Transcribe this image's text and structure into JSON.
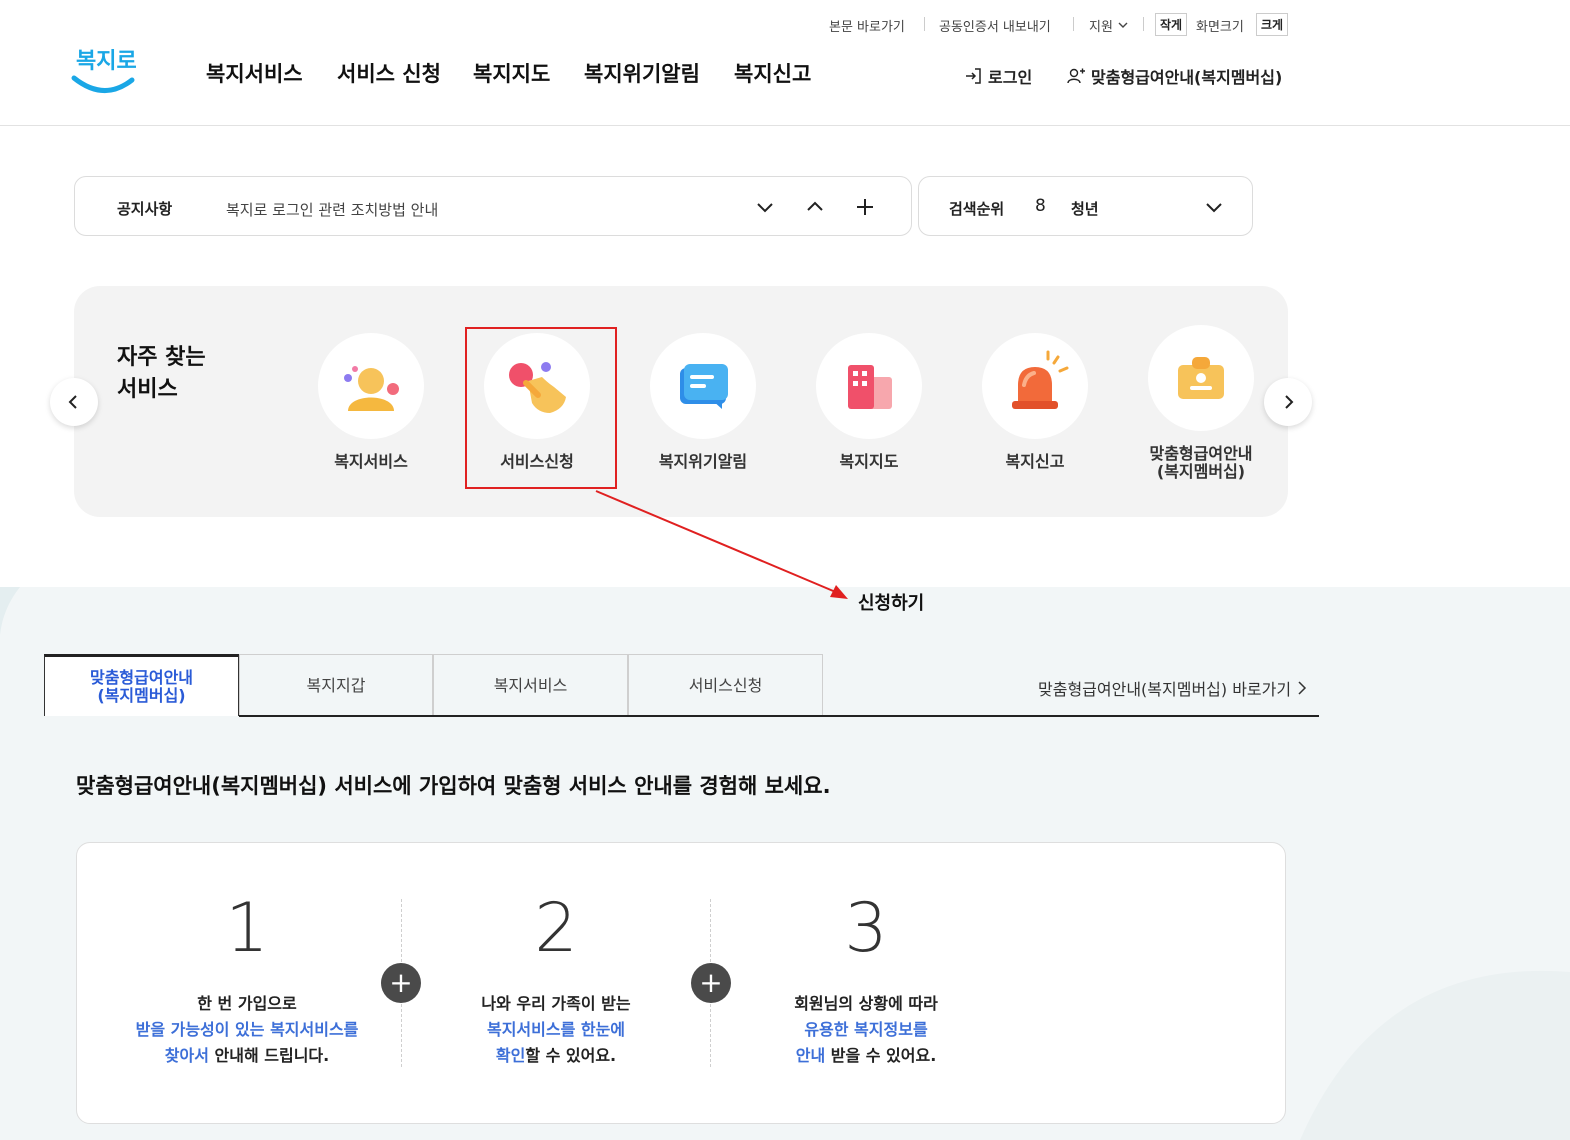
{
  "header": {
    "logo_text": "복지로",
    "util_links": [
      "본문 바로가기",
      "공동인증서 내보내기",
      "지원"
    ],
    "size_buttons": [
      "작게",
      "화면크기",
      "크게"
    ],
    "nav": [
      "복지서비스",
      "서비스 신청",
      "복지지도",
      "복지위기알림",
      "복지신고"
    ],
    "login": "로그인",
    "membership": "맞춤형급여안내(복지멤버십)"
  },
  "notice": {
    "label": "공지사항",
    "text": "복지로 로그인 관련 조치방법 안내"
  },
  "ranking": {
    "label": "검색순위",
    "rank": "8",
    "keyword": "청년"
  },
  "quick": {
    "title_line1": "자주 찾는",
    "title_line2": "서비스",
    "items": [
      {
        "label": "복지서비스"
      },
      {
        "label": "서비스신청"
      },
      {
        "label": "복지위기알림"
      },
      {
        "label": "복지지도"
      },
      {
        "label": "복지신고"
      },
      {
        "label_line1": "맞춤형급여안내",
        "label_line2": "(복지멤버십)"
      }
    ]
  },
  "annotation": {
    "text": "신청하기",
    "color": "#e02020"
  },
  "tabs": [
    {
      "line1": "맞춤형급여안내",
      "line2": "(복지멤버십)"
    },
    {
      "label": "복지지갑"
    },
    {
      "label": "복지서비스"
    },
    {
      "label": "서비스신청"
    }
  ],
  "tab_shortcut": "맞춤형급여안내(복지멤버십) 바로가기",
  "headline": "맞춤형급여안내(복지멤버십) 서비스에 가입하여 맞춤형 서비스 안내를 경험해 보세요.",
  "steps": [
    {
      "num": "1",
      "l1": "한 번 가입으로",
      "l2_blue": "받을 가능성이 있는 복지서비스를",
      "l3_blue": "찾아서",
      "l3_rest": " 안내해 드립니다."
    },
    {
      "num": "2",
      "l1": "나와 우리 가족이 받는",
      "l2_blue": "복지서비스를 한눈에",
      "l3_blue": "확인",
      "l3_rest": "할 수 있어요."
    },
    {
      "num": "3",
      "l1": "회원님의 상황에 따라",
      "l2_blue": "유용한 복지정보를",
      "l3_blue": "안내",
      "l3_rest": " 받을 수 있어요."
    }
  ],
  "colors": {
    "accent_blue": "#3d6fd8",
    "brand": "#1aa7e6",
    "tab_active_text": "#2a5bd7"
  }
}
